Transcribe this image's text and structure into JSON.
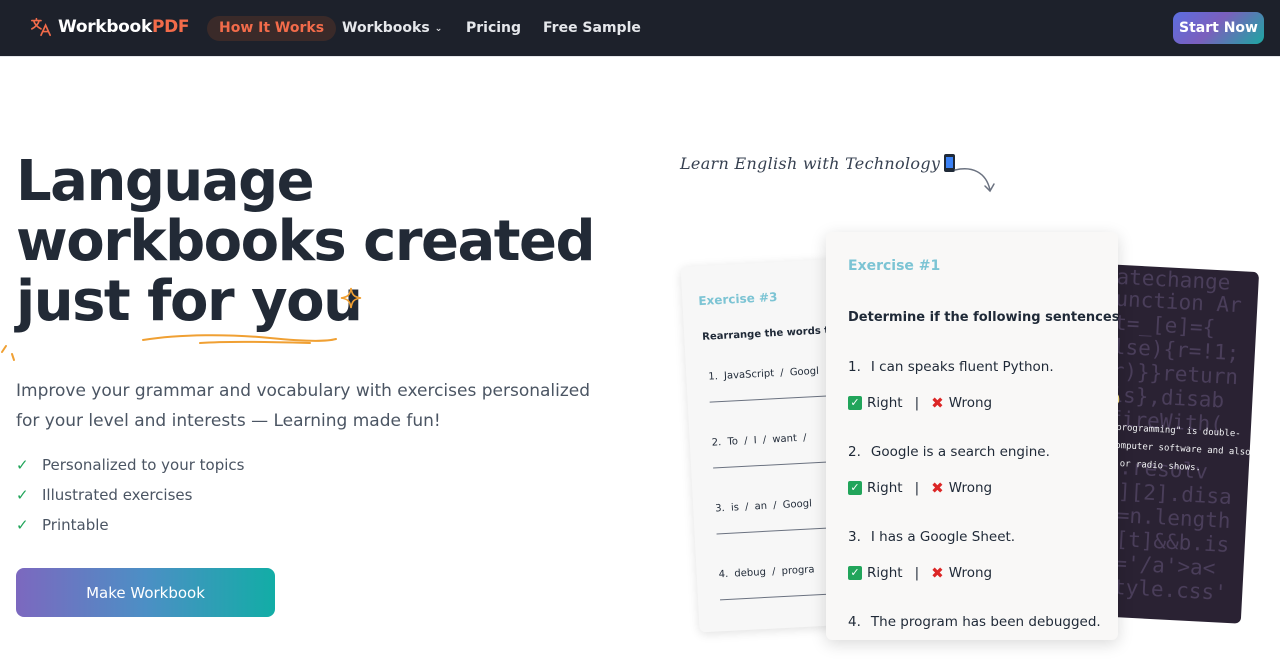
{
  "nav": {
    "logo_main": "Workbook",
    "logo_accent": "PDF",
    "links": [
      {
        "label": "How It Works"
      },
      {
        "label": "Workbooks"
      },
      {
        "label": "Pricing"
      },
      {
        "label": "Free Sample"
      }
    ],
    "cta": "Start Now"
  },
  "hero": {
    "title_lines": [
      "Language",
      "workbooks created",
      "just for you"
    ],
    "subtitle": "Improve your grammar and vocabulary with exercises personalized for your level and interests — Learning made fun!",
    "features": [
      "Personalized to your topics",
      "Illustrated exercises",
      "Printable"
    ],
    "button": "Make Workbook"
  },
  "illustration": {
    "handwritten": "Learn English with Technology",
    "back_card": {
      "code_lines": [
        "atechange",
        "unction Ar",
        "t=_[e]={",
        "lse){r=!1;",
        "r)}}return",
        "is},disab",
        "fireWith(",
        "e.resolv",
        "e][2].disa",
        "r=n.length",
        "n[t]&&b.is",
        "f='/a'>a<",
        "style.css'"
      ],
      "tip_lines": [
        "\"programming\" is double-",
        "computer software and also",
        "/ or radio shows."
      ]
    },
    "left_card": {
      "title": "Exercise #3",
      "instruction": "Rearrange the words to",
      "items": [
        "1.  JavaScript  /   Googl",
        "2.  To  /   I  /   want  /",
        "3.  is  /   an  /   Googl",
        "4.  debug  /   progra"
      ]
    },
    "main_card": {
      "title": "Exercise #1",
      "instruction": "Determine if the following sentences are g",
      "questions": [
        {
          "num": "1.",
          "text": "I can speaks fluent Python."
        },
        {
          "num": "2.",
          "text": "Google is a search engine."
        },
        {
          "num": "3.",
          "text": "I has a Google Sheet."
        },
        {
          "num": "4.",
          "text": "The program has been debugged."
        }
      ],
      "right_label": "Right",
      "separator": "|",
      "wrong_label": "Wrong"
    }
  }
}
